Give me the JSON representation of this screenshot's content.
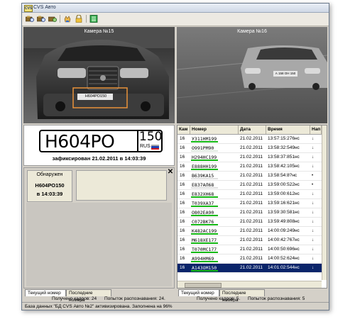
{
  "window": {
    "title": "CVS Авто",
    "app_icon_text": "CVS"
  },
  "toolbar": {
    "icons": [
      "camera-search-icon",
      "camera-search-icon",
      "camera-refresh-icon",
      "hand-pointer-icon",
      "lock-icon",
      "green-panel-icon"
    ]
  },
  "cameras": [
    {
      "label": "Камера №15"
    },
    {
      "label": "Камера №16"
    }
  ],
  "camera1_overlay_plate": "Н604РО150",
  "camera2_overlay_plate": "А 158 ОН 150",
  "plate": {
    "main": "Н604РО",
    "region": "150",
    "country": "RUS",
    "flag_colors": [
      "#ffffff",
      "#1c3fb0",
      "#d0191f"
    ],
    "caption": "зафиксирован 21.02.2011 в 14:03:39"
  },
  "detected": {
    "header": "Обнаружен",
    "plate": "Н604РО150",
    "time": "в 14:03:39",
    "close": "✕"
  },
  "left_tabs": [
    "Текущий номер",
    "Последние номера"
  ],
  "left_status": {
    "frames": "Получено кадров: 24",
    "attempts": "Попыток распознавания: 24."
  },
  "table": {
    "headers": [
      "Кам",
      "Номер",
      "Дата",
      "Время",
      "Нап"
    ],
    "rows": [
      {
        "cam": "16",
        "plate": "У311НМ199",
        "date": "21.02.2011",
        "time": "13:57:15:276нс",
        "dir": "↓",
        "bar": "#14b814",
        "sel": false
      },
      {
        "cam": "16",
        "plate": "О991РМ90",
        "date": "21.02.2011",
        "time": "13:58:32:549нс",
        "dir": "↓",
        "bar": "#dfe8df",
        "sel": false
      },
      {
        "cam": "16",
        "plate": "Н294НС199",
        "date": "21.02.2011",
        "time": "13:58:37:851нс",
        "dir": "↓",
        "bar": "#14b814",
        "sel": false
      },
      {
        "cam": "16",
        "plate": "Е888НН199",
        "date": "21.02.2011",
        "time": "13:58:42:105нс",
        "dir": "↓",
        "bar": "#14b814",
        "sel": false
      },
      {
        "cam": "16",
        "plate": "В639КА15",
        "date": "21.02.2011",
        "time": "13:58:54:8?нс",
        "dir": "•",
        "bar": "#e0e0e0",
        "sel": false
      },
      {
        "cam": "16",
        "plate": "Е837АЛ68",
        "date": "21.02.2011",
        "time": "13:59:00:522нс",
        "dir": "•",
        "bar": "#e0e0e0",
        "sel": false
      },
      {
        "cam": "16",
        "plate": "Е832ХН68",
        "date": "21.02.2011",
        "time": "13:59:00:612нс",
        "dir": "↓",
        "bar": "#14b814",
        "sel": false
      },
      {
        "cam": "16",
        "plate": "Т039ХА37",
        "date": "21.02.2011",
        "time": "13:59:16:621нс",
        "dir": "↓",
        "bar": "#14b814",
        "sel": false
      },
      {
        "cam": "16",
        "plate": "О802ЕА90",
        "date": "21.02.2011",
        "time": "13:59:30:581нс",
        "dir": "↓",
        "bar": "#14b814",
        "sel": false
      },
      {
        "cam": "16",
        "plate": "С072ВК76",
        "date": "21.02.2011",
        "time": "13:59:49:808нс",
        "dir": "↓",
        "bar": "#14b814",
        "sel": false
      },
      {
        "cam": "16",
        "plate": "К482АС199",
        "date": "21.02.2011",
        "time": "14:00:09:249нс",
        "dir": "↓",
        "bar": "#14b814",
        "sel": false
      },
      {
        "cam": "16",
        "plate": "М618ХЕ177",
        "date": "21.02.2011",
        "time": "14:00:42:767нс",
        "dir": "↓",
        "bar": "#14b814",
        "sel": false
      },
      {
        "cam": "16",
        "plate": "Т070МС177",
        "date": "21.02.2011",
        "time": "14:00:50:696нс",
        "dir": "↓",
        "bar": "#14b814",
        "sel": false
      },
      {
        "cam": "16",
        "plate": "А994НМ69",
        "date": "21.02.2011",
        "time": "14:00:52:624нс",
        "dir": "↓",
        "bar": "#14b814",
        "sel": false
      },
      {
        "cam": "16",
        "plate": "А143ОМ150",
        "date": "21.02.2011",
        "time": "14:01:02:544нс",
        "dir": "↓",
        "bar": "#14b814",
        "sel": true
      }
    ]
  },
  "right_tabs": [
    "Текущий номер",
    "Последние номера"
  ],
  "right_status": {
    "frames": "Получено кадров: 5.",
    "attempts": "Попыток распознавания: 5"
  },
  "statusbar": "База данных \"БД CVS Авто №2\" активизирована. Заполнена на 96%"
}
